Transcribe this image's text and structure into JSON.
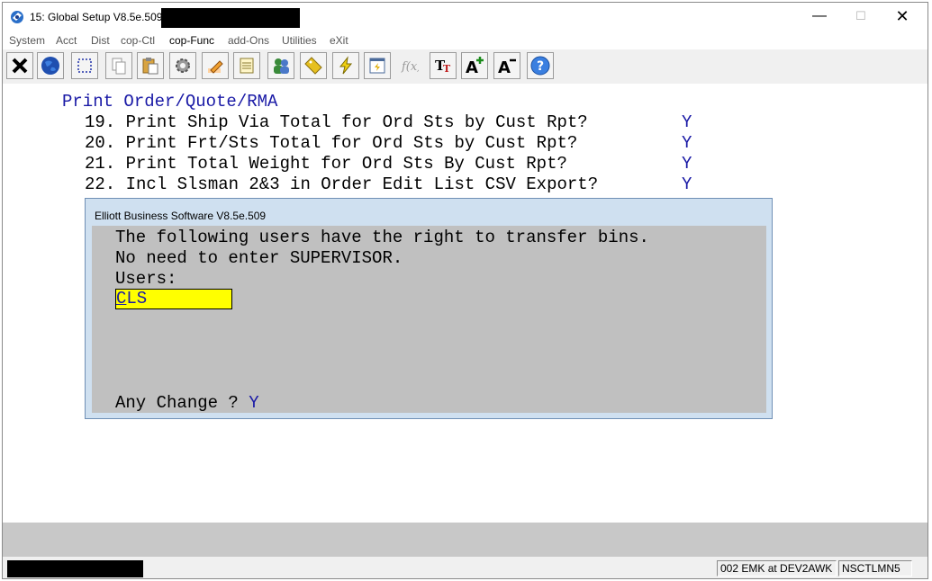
{
  "window": {
    "title": "15: Global Setup V8.5e.509 -",
    "controls": {
      "minimize": "—",
      "maximize": "☐",
      "close": "✕"
    }
  },
  "menu": [
    "System",
    "Acct",
    "Dist",
    "cop-Ctl",
    "cop-Func",
    "add-Ons",
    "Utilities",
    "eXit"
  ],
  "toolbar": {
    "buttons": [
      "close-icon",
      "globe-icon",
      "select-icon",
      "copy-icon",
      "paste-icon",
      "settings-icon",
      "edit-icon",
      "notepad-icon",
      "users-icon",
      "tag-icon",
      "lightning-icon",
      "run-icon",
      "function-icon",
      "font-icon",
      "font-larger-icon",
      "font-smaller-icon",
      "help-icon"
    ]
  },
  "screen": {
    "heading": "Print Order/Quote/RMA",
    "lines": [
      {
        "text": "19. Print Ship Via Total for Ord Sts by Cust Rpt?",
        "value": "Y"
      },
      {
        "text": "20. Print Frt/Sts Total for Ord Sts by Cust Rpt?",
        "value": "Y"
      },
      {
        "text": "21. Print Total Weight for Ord Sts By Cust Rpt?",
        "value": "Y"
      },
      {
        "text": "22. Incl Slsman 2&3 in Order Edit List CSV Export?",
        "value": "Y"
      }
    ]
  },
  "dialog": {
    "title": "Elliott Business Software V8.5e.509",
    "line1": "The following users have the right to transfer bins.",
    "line2": "No need to enter SUPERVISOR.",
    "users_label": "Users:",
    "user_value_first": "C",
    "user_value_rest": "LS",
    "change_prompt": "Any Change ?",
    "change_value": "Y"
  },
  "status": {
    "user_info": "002 EMK at DEV2AWK",
    "station": "NSCTLMN5"
  }
}
